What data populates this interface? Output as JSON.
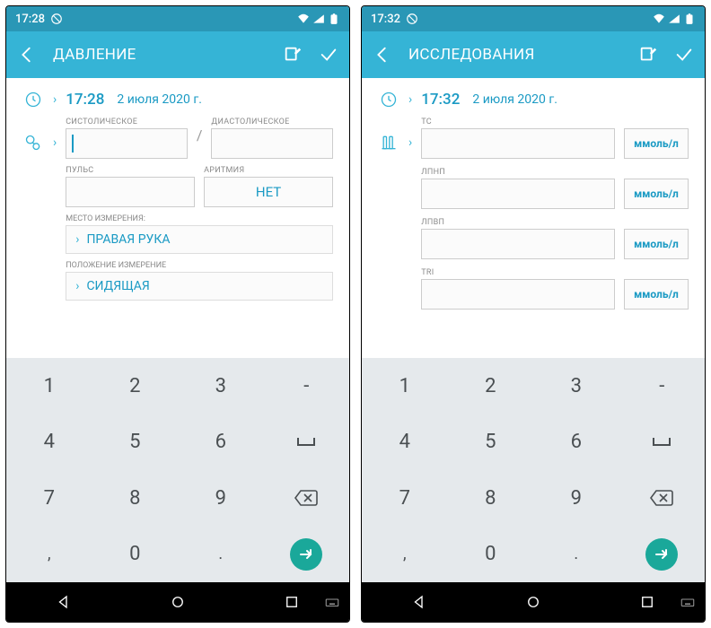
{
  "left": {
    "status": {
      "time": "17:28"
    },
    "appbar": {
      "title": "ДАВЛЕНИЕ"
    },
    "datetime": {
      "time": "17:28",
      "date": "2 июля 2020 г."
    },
    "labels": {
      "systolic": "СИСТОЛИЧЕСКОЕ",
      "diastolic": "ДИАСТОЛИЧЕСКОЕ",
      "pulse": "ПУЛЬС",
      "arrhythmia": "АРИТМИЯ",
      "place": "МЕСТО ИЗМЕРЕНИЯ:",
      "position": "ПОЛОЖЕНИЕ ИЗМЕРЕНИЕ"
    },
    "values": {
      "arrhythmia": "НЕТ",
      "place": "ПРАВАЯ РУКА",
      "position": "СИДЯЩАЯ"
    }
  },
  "right": {
    "status": {
      "time": "17:32"
    },
    "appbar": {
      "title": "ИССЛЕДОВАНИЯ"
    },
    "datetime": {
      "time": "17:32",
      "date": "2 июля 2020 г."
    },
    "labels": {
      "tc": "TC",
      "ldl": "ЛПНП",
      "hdl": "ЛПВП",
      "tri": "TRI"
    },
    "unit": "ммоль/л"
  },
  "keys": {
    "r1": [
      "1",
      "2",
      "3"
    ],
    "r2": [
      "4",
      "5",
      "6"
    ],
    "r3": [
      "7",
      "8",
      "9"
    ],
    "r4": [
      ",",
      "0",
      "."
    ],
    "dash": "-",
    "under": "⌴"
  }
}
